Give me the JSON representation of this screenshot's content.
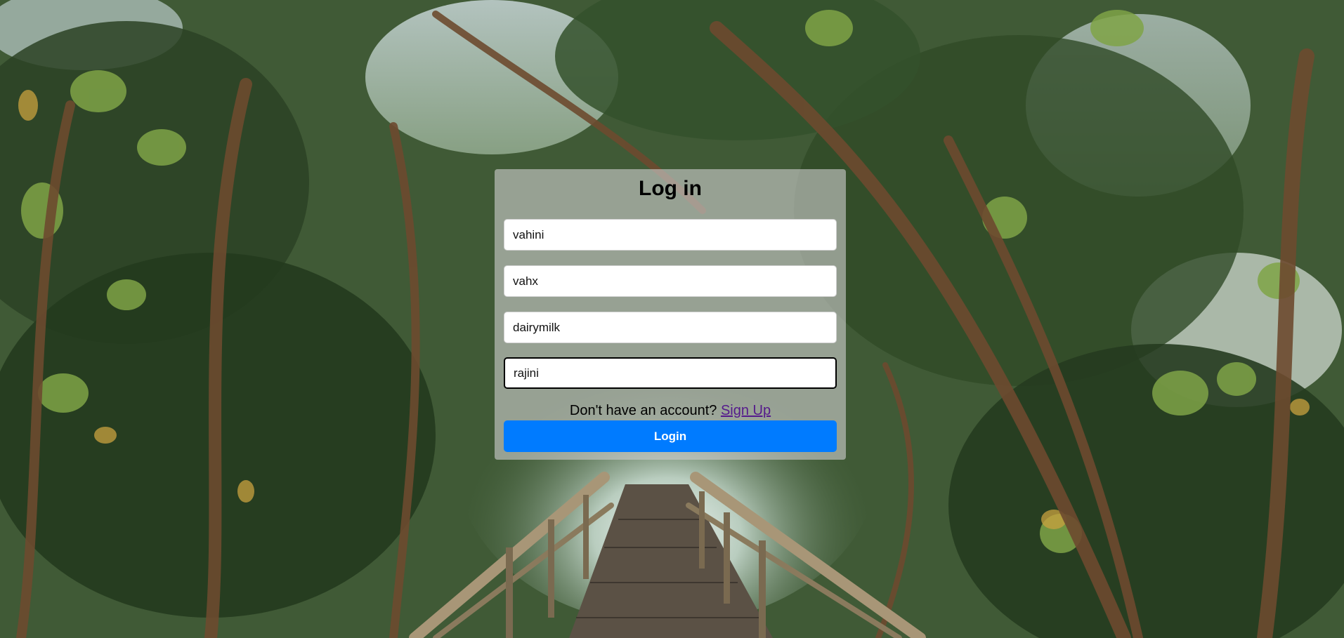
{
  "page": {
    "background": "forest-boardwalk-photo"
  },
  "login_form": {
    "title": "Log in",
    "fields": [
      {
        "value": "vahini"
      },
      {
        "value": "vahx"
      },
      {
        "value": "dairymilk"
      },
      {
        "value": "rajini"
      }
    ],
    "signup_prompt": "Don't have an account?",
    "signup_link": "Sign Up",
    "login_button": "Login"
  },
  "colors": {
    "button": "#007bff",
    "link": "#551a8b",
    "panel": "rgba(205,205,205,0.62)"
  }
}
